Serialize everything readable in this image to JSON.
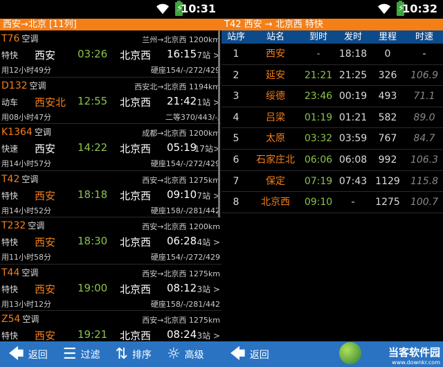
{
  "status_left": {
    "time": "10:31"
  },
  "status_right": {
    "time": "10:32"
  },
  "left": {
    "title": "西安→北京 [11列]",
    "trains": [
      {
        "num": "T76",
        "ac": "空调",
        "route": "兰州→北京西 1200km",
        "type": "特快",
        "from": "西安",
        "from_hl": false,
        "dep": "03:26",
        "to": "北京西",
        "arr": "16:15",
        "stops": "7站 >",
        "dur": "用12小时49分",
        "seats": "硬座154/-/272/429"
      },
      {
        "num": "D132",
        "ac": "空调",
        "route": "西安北→北京西 1194km",
        "type": "动车",
        "from": "西安北",
        "from_hl": true,
        "dep": "12:55",
        "to": "北京西",
        "arr": "21:42",
        "stops": "1站 >",
        "dur": "用08小时47分",
        "seats": "二等370/443/-/"
      },
      {
        "num": "K1364",
        "ac": "空调",
        "route": "成都→北京西 1200km",
        "type": "快速",
        "from": "西安",
        "from_hl": false,
        "dep": "14:22",
        "to": "北京西",
        "arr": "05:19",
        "stops": "17站>",
        "dur": "用14小时57分",
        "seats": "硬座154/-/272/429"
      },
      {
        "num": "T42",
        "ac": "空调",
        "route": "西安→北京西 1275km",
        "type": "特快",
        "from": "西安",
        "from_hl": true,
        "dep": "18:18",
        "to": "北京西",
        "arr": "09:10",
        "stops": "7站 >",
        "dur": "用14小时52分",
        "seats": "硬座158/-/281/442"
      },
      {
        "num": "T232",
        "ac": "空调",
        "route": "西安→北京西 1200km",
        "type": "特快",
        "from": "西安",
        "from_hl": true,
        "dep": "18:30",
        "to": "北京西",
        "arr": "06:28",
        "stops": "4站 >",
        "dur": "用11小时58分",
        "seats": "硬座154/-/272/429"
      },
      {
        "num": "T44",
        "ac": "空调",
        "route": "西安→北京西 1275km",
        "type": "特快",
        "from": "西安",
        "from_hl": true,
        "dep": "19:00",
        "to": "北京西",
        "arr": "08:12",
        "stops": "3站 >",
        "dur": "用13小时12分",
        "seats": "硬座158/-/281/442"
      },
      {
        "num": "Z54",
        "ac": "空调",
        "route": "西安→北京西 1275km",
        "type": "特快",
        "from": "西安",
        "from_hl": true,
        "dep": "19:21",
        "to": "北京西",
        "arr": "08:24",
        "stops": "3站 >",
        "dur": "",
        "seats": ""
      }
    ],
    "bottom": {
      "back": "返回",
      "filter": "过滤",
      "sort": "排序",
      "advanced": "高级"
    }
  },
  "right": {
    "title": "T42 西安 → 北京西 特快",
    "headers": [
      "站序",
      "站名",
      "到时",
      "发时",
      "里程",
      "时速"
    ],
    "rows": [
      [
        "1",
        "西安",
        "-",
        "18:18",
        "0",
        "-"
      ],
      [
        "2",
        "延安",
        "21:21",
        "21:25",
        "326",
        "106.9"
      ],
      [
        "3",
        "绥德",
        "23:46",
        "00:19",
        "493",
        "71.1"
      ],
      [
        "4",
        "吕梁",
        "01:19",
        "01:21",
        "582",
        "89.0"
      ],
      [
        "5",
        "太原",
        "03:32",
        "03:59",
        "767",
        "84.7"
      ],
      [
        "6",
        "石家庄北",
        "06:06",
        "06:08",
        "992",
        "106.3"
      ],
      [
        "7",
        "保定",
        "07:19",
        "07:43",
        "1129",
        "115.8"
      ],
      [
        "8",
        "北京西",
        "09:10",
        "-",
        "1275",
        "100.7"
      ]
    ],
    "bottom": {
      "back": "返回"
    },
    "watermark": {
      "name": "当客软件园",
      "url": "www.downkr.com"
    }
  },
  "colors": {
    "accent": "#f57f17",
    "time_green": "#8bc34a",
    "header_blue": "#0d4a8a",
    "bottombar_blue": "#2a73c2"
  }
}
